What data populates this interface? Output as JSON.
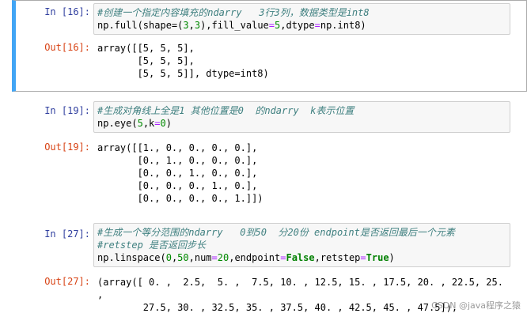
{
  "cells": [
    {
      "in_prompt": "In  [16]:",
      "out_prompt": "Out[16]:",
      "comment": "#创建一个指定内容填充的ndarry   3行3列，数据类型是int8",
      "code": {
        "a": "np.full(shape=(",
        "n1": "3",
        "c1": ",",
        "n2": "3",
        "b": "),fill_value",
        "eq1": "=",
        "n3": "5",
        "c2": ",dtype",
        "eq2": "=",
        "d": "np.int8)"
      },
      "output_lines": [
        "array([[5, 5, 5],",
        "       [5, 5, 5],",
        "       [5, 5, 5]], dtype=int8)"
      ]
    },
    {
      "in_prompt": "In  [19]:",
      "out_prompt": "Out[19]:",
      "comment": "#生成对角线上全是1 其他位置是0  的ndarry  k表示位置",
      "code": {
        "a": "np.eye(",
        "n1": "5",
        "b": ",k",
        "eq": "=",
        "n2": "0",
        "c": ")"
      },
      "output_lines": [
        "array([[1., 0., 0., 0., 0.],",
        "       [0., 1., 0., 0., 0.],",
        "       [0., 0., 1., 0., 0.],",
        "       [0., 0., 0., 1., 0.],",
        "       [0., 0., 0., 0., 1.]])"
      ]
    },
    {
      "in_prompt": "In  [27]:",
      "out_prompt": "Out[27]:",
      "comment1": "#生成一个等分范围的ndarry   0到50  分20份 endpoint是否返回最后一个元素",
      "comment2": "#retstep 是否返回步长",
      "code": {
        "a": "np.linspace(",
        "n1": "0",
        "c1": ",",
        "n2": "50",
        "b": ",num",
        "eq1": "=",
        "n3": "20",
        "c2": ",endpoint",
        "eq2": "=",
        "k1": "False",
        "c3": ",retstep",
        "eq3": "=",
        "k2": "True",
        "d": ")"
      },
      "output_lines": [
        "(array([ 0. ,  2.5,  5. ,  7.5, 10. , 12.5, 15. , 17.5, 20. , 22.5, 25. ",
        ",",
        "        27.5, 30. , 32.5, 35. , 37.5, 40. , 42.5, 45. , 47.5]),"
      ]
    }
  ],
  "watermark": "CSDN @java程序之猿",
  "colors": {
    "selected_border": "#42a5f5",
    "in_prompt": "#303f9f",
    "out_prompt": "#d84315"
  }
}
